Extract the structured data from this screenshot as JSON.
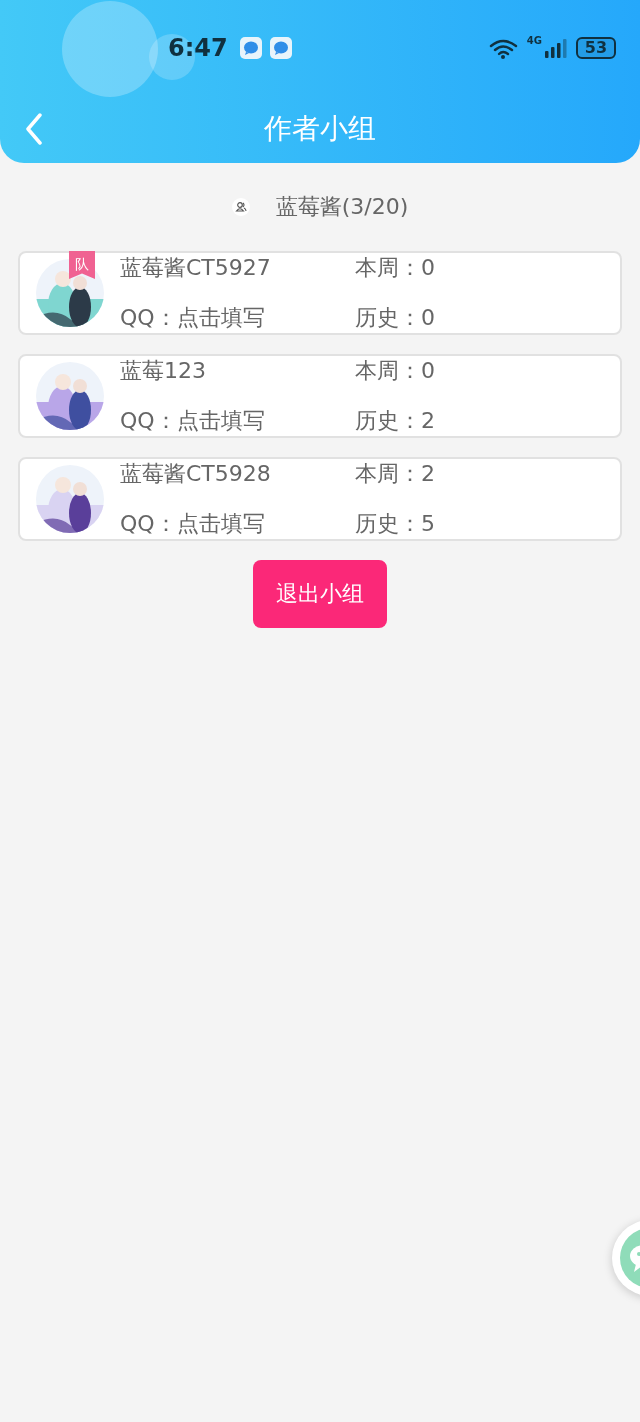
{
  "status_bar": {
    "time": "6:47",
    "network": "4G",
    "battery": "53"
  },
  "header": {
    "title": "作者小组"
  },
  "group": {
    "name": "蓝莓酱(3/20)"
  },
  "members": [
    {
      "name": "蓝莓酱CT5927",
      "badge": "队",
      "week_label": "本周：",
      "week": "0",
      "qq_label": "QQ：",
      "qq": "点击填写",
      "history_label": "历史：",
      "history": "0",
      "kind": "picture"
    },
    {
      "name": "蓝莓123",
      "week_label": "本周：",
      "week": "0",
      "qq_label": "QQ：",
      "qq": "点击填写",
      "history_label": "历史：",
      "history": "2",
      "kind": "picture"
    },
    {
      "name": "蓝莓酱CT5928",
      "week_label": "本周：",
      "week": "2",
      "qq_label": "QQ：",
      "qq": "点击填写",
      "history_label": "历史：",
      "history": "5",
      "kind": "picture"
    }
  ],
  "leave_button": "退出小组"
}
